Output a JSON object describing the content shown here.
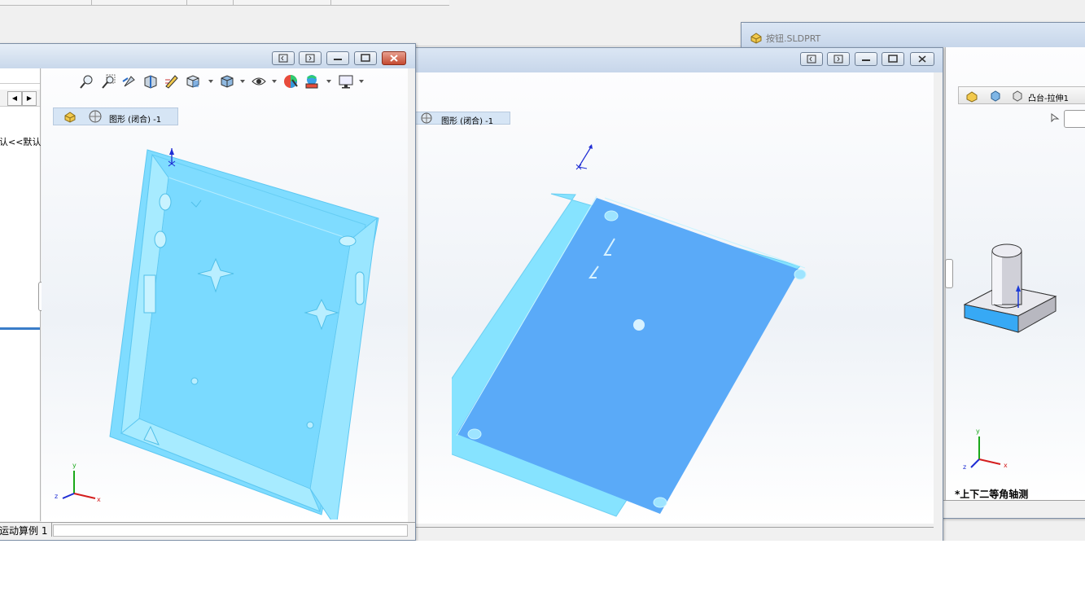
{
  "windows": {
    "left": {
      "breadcrumb_label": "图形 (闭合) -1",
      "tree_partial_label": "认<<默认",
      "status_label": "运动算例 1"
    },
    "middle": {
      "breadcrumb_label": "图形 (闭合) -1"
    },
    "right": {
      "tab_title": "按钮.SLDPRT",
      "breadcrumb_label": "凸台-拉伸1",
      "view_label": "*上下二等角轴测"
    }
  },
  "triad": {
    "x_label": "x",
    "y_label": "y",
    "z_label": "z"
  },
  "colors": {
    "model_face": "#5aaaf8",
    "model_side": "#80e0ff",
    "titlebar": "#c7d6ea",
    "close_button": "#c44a30"
  },
  "icons": {
    "toolbar": [
      "zoom-to-fit-icon",
      "zoom-area-icon",
      "previous-view-icon",
      "section-view-icon",
      "dynamic-annotation-icon",
      "view-orientation-icon",
      "display-style-icon",
      "hide-show-icon",
      "edit-appearance-icon",
      "apply-scene-icon",
      "view-settings-icon"
    ]
  }
}
